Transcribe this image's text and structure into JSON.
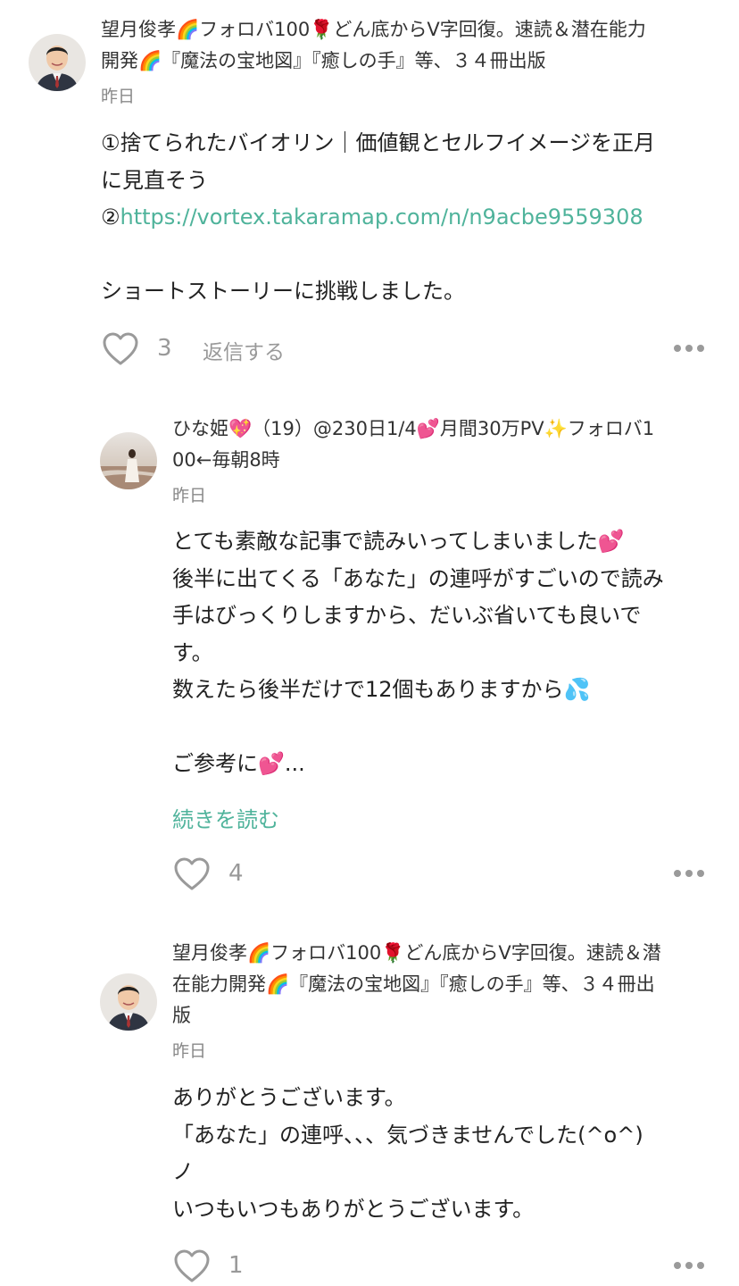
{
  "comments": [
    {
      "author": "望月俊孝🌈フォロバ100🌹どん底からV字回復。速読＆潜在能力開発🌈『魔法の宝地図』『癒しの手』等、３４冊出版",
      "author_lines": [
        "望月俊孝🌈フォロバ100🌹どん底からV字回復。速読＆潜在能力",
        "開発🌈『魔法の宝地図』『癒しの手』等、３４冊出版"
      ],
      "date": "昨日",
      "body_lines": [
        "①捨てられたバイオリン｜価値観とセルフイメージを正月",
        "に見直そう",
        "②",
        "https://vortex.takaramap.com/n/n9acbe9559308",
        "",
        "ショートストーリーに挑戦しました。"
      ],
      "like_count": "3",
      "reply_label": "返信する",
      "heart_icon": "heart-outline-icon",
      "more_icon": "more-dots-icon"
    },
    {
      "author": "ひな姫💖（19）@230日1/4💕月間30万PV✨フォロバ100←毎朝8時",
      "author_lines": [
        "ひな姫💖（19）@230日1/4💕月間30万PV✨フォロバ1",
        "00←毎朝8時"
      ],
      "date": "昨日",
      "body_lines": [
        "とても素敵な記事で読みいってしまいました💕",
        "後半に出てくる「あなた」の連呼がすごいので読み",
        "手はびっくりしますから、だいぶ省いても良いで",
        "す。",
        "数えたら後半だけで12個もありますから💦",
        "",
        "ご参考に💕..."
      ],
      "read_more": "続きを読む",
      "like_count": "4"
    },
    {
      "author": "望月俊孝🌈フォロバ100🌹どん底からV字回復。速読＆潜在能力開発🌈『魔法の宝地図』『癒しの手』等、３４冊出版",
      "author_lines": [
        "望月俊孝🌈フォロバ100🌹どん底からV字回復。速読＆潜",
        "在能力開発🌈『魔法の宝地図』『癒しの手』等、３４冊出",
        "版"
      ],
      "date": "昨日",
      "body_lines": [
        "ありがとうございます。",
        "「あなた」の連呼、、、気づきませんでした(^o^)",
        "ノ",
        "いつもいつもありがとうございます。"
      ],
      "like_count": "1"
    }
  ],
  "colors": {
    "link": "#4fb39b",
    "meta": "#888888",
    "icon": "#9a9a9a"
  }
}
